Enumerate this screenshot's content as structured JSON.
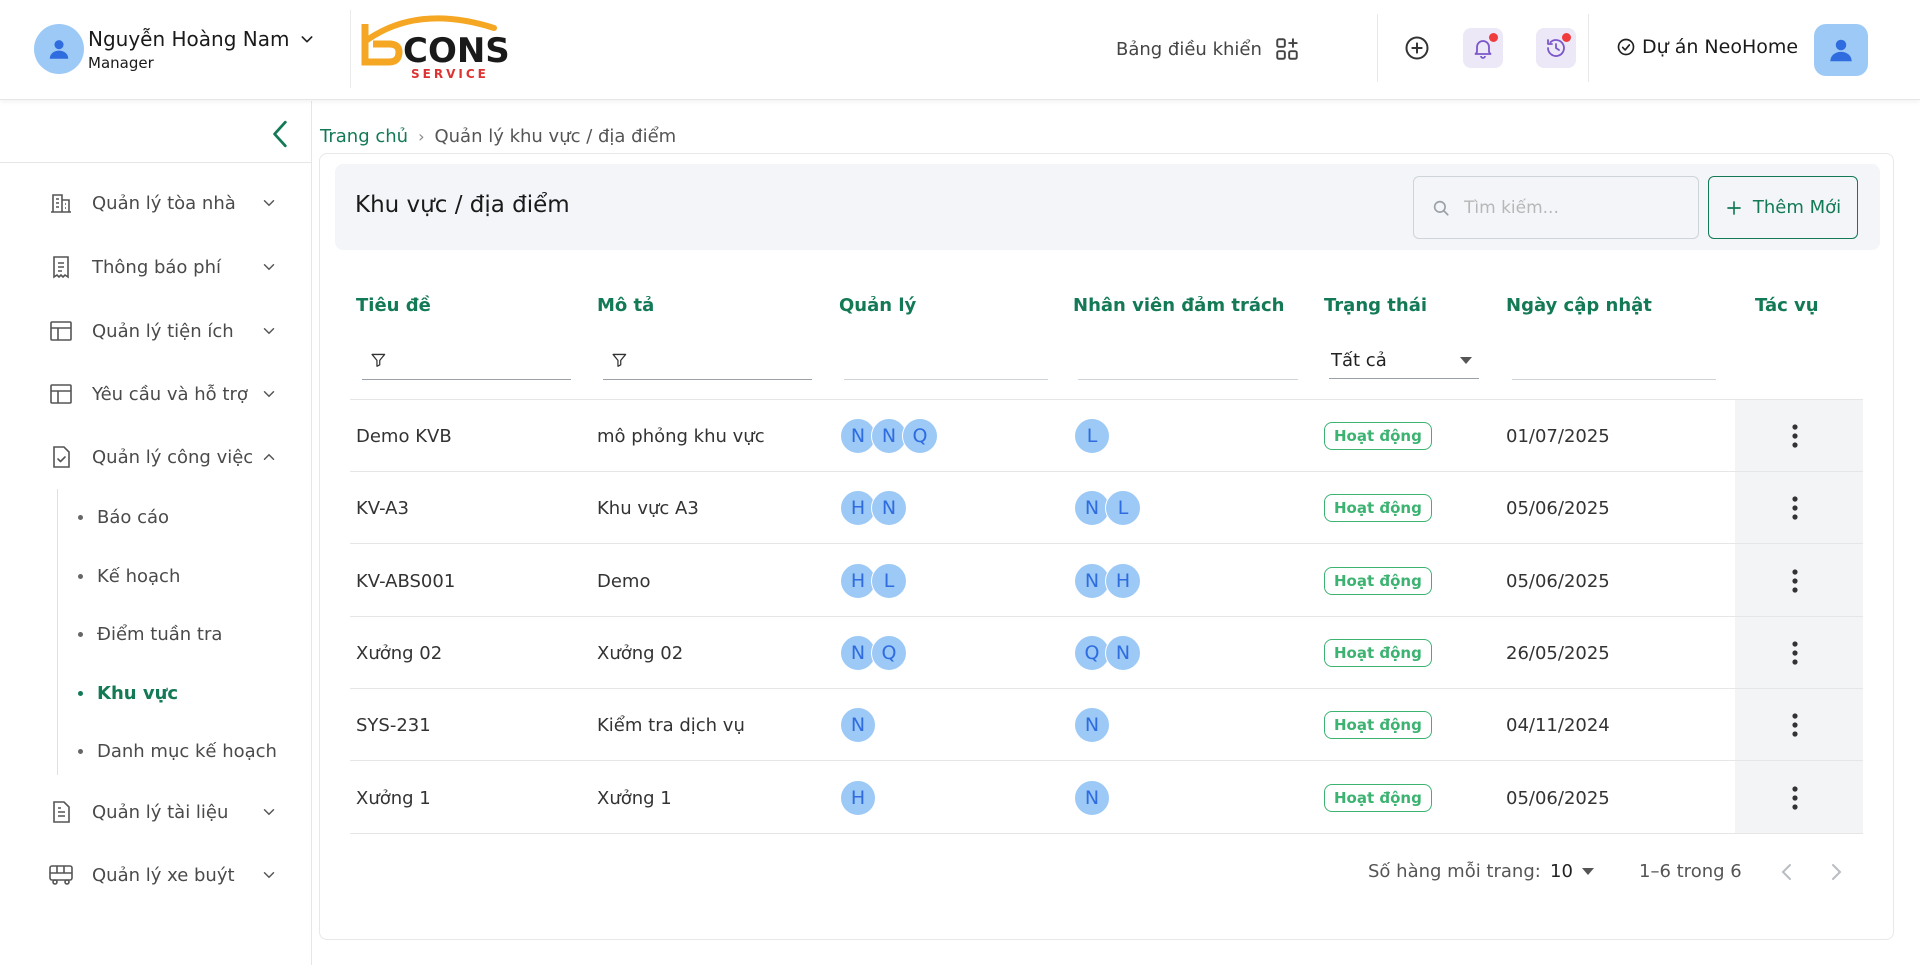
{
  "header": {
    "user_name": "Nguyễn Hoàng Nam",
    "user_role": "Manager",
    "logo_text": "CONS",
    "logo_subtext": "SERVICE",
    "dashboard_label": "Bảng điều khiển",
    "project_label": "Dự án NeoHome",
    "icons": [
      "user-icon",
      "chevron-down-icon",
      "grid-plus-icon",
      "add-circle-icon",
      "bell-icon",
      "history-icon",
      "check-circle-icon",
      "profile-avatar-icon"
    ]
  },
  "sidebar": {
    "items": [
      {
        "label": "Quản lý tòa nhà",
        "icon": "building-icon"
      },
      {
        "label": "Thông báo phí",
        "icon": "receipt-icon"
      },
      {
        "label": "Quản lý tiện ích",
        "icon": "layout-icon"
      },
      {
        "label": "Yêu cầu và hỗ trợ",
        "icon": "layout-icon"
      },
      {
        "label": "Quản lý công việc",
        "icon": "task-check-icon"
      },
      {
        "label": "Quản lý tài liệu",
        "icon": "document-icon"
      },
      {
        "label": "Quản lý xe buýt",
        "icon": "bus-icon"
      }
    ],
    "sub_items": [
      "Báo cáo",
      "Kế hoạch",
      "Điểm tuần tra",
      "Khu vực",
      "Danh mục kế hoạch"
    ],
    "active_sub_item": "Khu vực"
  },
  "breadcrumb": {
    "home": "Trang chủ",
    "separator": "›",
    "current": "Quản lý khu vực / địa điểm"
  },
  "page": {
    "title": "Khu vực / địa điểm",
    "search_placeholder": "Tìm kiếm...",
    "add_label": "Thêm Mới"
  },
  "table": {
    "columns": [
      "Tiêu đề",
      "Mô tả",
      "Quản lý",
      "Nhân viên đảm trách",
      "Trạng thái",
      "Ngày cập nhật",
      "Tác vụ"
    ],
    "status_filter": "Tất cả",
    "rows": [
      {
        "title": "Demo KVB",
        "desc": "mô phỏng khu vực",
        "managers": [
          "N",
          "N",
          "Q"
        ],
        "staff": [
          "L"
        ],
        "status": "Hoạt động",
        "date": "01/07/2025"
      },
      {
        "title": "KV-A3",
        "desc": "Khu vực A3",
        "managers": [
          "H",
          "N"
        ],
        "staff": [
          "N",
          "L"
        ],
        "status": "Hoạt động",
        "date": "05/06/2025"
      },
      {
        "title": "KV-ABS001",
        "desc": "Demo",
        "managers": [
          "H",
          "L"
        ],
        "staff": [
          "N",
          "H"
        ],
        "status": "Hoạt động",
        "date": "05/06/2025"
      },
      {
        "title": "Xưởng 02",
        "desc": "Xưởng 02",
        "managers": [
          "N",
          "Q"
        ],
        "staff": [
          "Q",
          "N"
        ],
        "status": "Hoạt động",
        "date": "26/05/2025"
      },
      {
        "title": "SYS-231",
        "desc": "Kiểm tra dịch vụ",
        "managers": [
          "N"
        ],
        "staff": [
          "N"
        ],
        "status": "Hoạt động",
        "date": "04/11/2024"
      },
      {
        "title": "Xưởng 1",
        "desc": "Xưởng 1",
        "managers": [
          "H"
        ],
        "staff": [
          "N"
        ],
        "status": "Hoạt động",
        "date": "05/06/2025"
      }
    ]
  },
  "pagination": {
    "rows_per_page_label": "Số hàng mỗi trang:",
    "rows_per_page": "10",
    "range": "1–6 trong 6"
  },
  "colors": {
    "accent": "#137a55",
    "status_active": "#3cb371",
    "avatar_bg": "#9cc9f5",
    "avatar_text": "#2e6ce0",
    "notification_dot": "#f03c3c"
  }
}
